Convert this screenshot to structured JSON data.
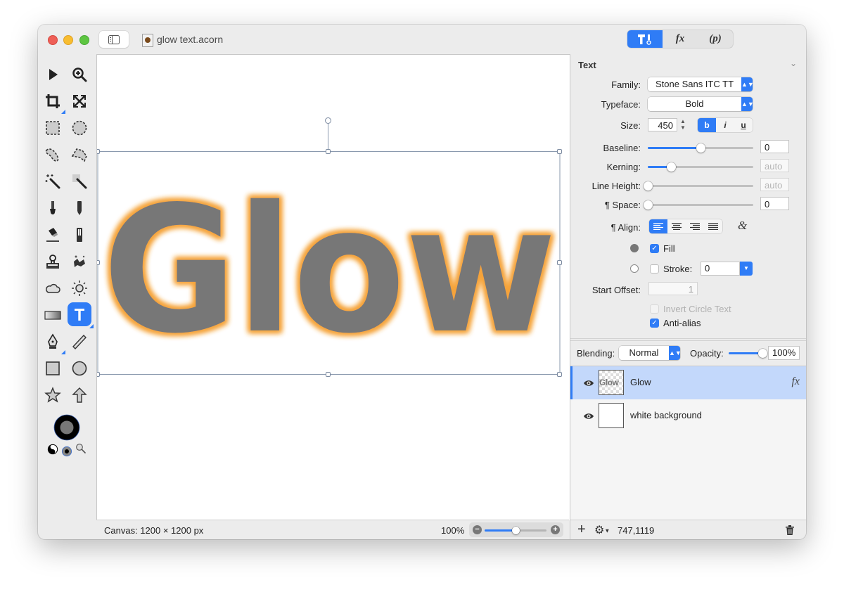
{
  "window": {
    "title": "glow text.acorn",
    "doc_icon": "acorn-document-icon"
  },
  "mode_switcher": {
    "items": [
      {
        "name": "tools",
        "icon": "hammer-brush-icon",
        "label": "",
        "active": true
      },
      {
        "name": "filters",
        "icon": "fx-icon",
        "label": "fx",
        "active": false
      },
      {
        "name": "plugins",
        "icon": "p-icon",
        "label": "(p)",
        "active": false
      }
    ]
  },
  "toolbox": {
    "tools": [
      {
        "name": "move-arrow-tool"
      },
      {
        "name": "zoom-tool"
      },
      {
        "name": "crop-tool"
      },
      {
        "name": "resize-tool"
      },
      {
        "name": "rect-select-tool"
      },
      {
        "name": "ellipse-select-tool"
      },
      {
        "name": "lasso-tool"
      },
      {
        "name": "polygon-lasso-tool"
      },
      {
        "name": "magic-wand-tool"
      },
      {
        "name": "instant-alpha-tool"
      },
      {
        "name": "brush-tool"
      },
      {
        "name": "pencil-tool"
      },
      {
        "name": "paint-bucket-tool"
      },
      {
        "name": "eraser-tool"
      },
      {
        "name": "clone-stamp-tool"
      },
      {
        "name": "smudge-tool"
      },
      {
        "name": "blur-cloud-tool"
      },
      {
        "name": "dodge-burn-sun-tool"
      },
      {
        "name": "gradient-tool"
      },
      {
        "name": "text-tool",
        "active": true
      },
      {
        "name": "bezier-pen-tool"
      },
      {
        "name": "line-tool"
      },
      {
        "name": "rectangle-shape-tool"
      },
      {
        "name": "oval-shape-tool"
      },
      {
        "name": "star-shape-tool"
      },
      {
        "name": "arrow-shape-tool"
      }
    ],
    "stroke_color": "#000000",
    "fill_color": "#777777"
  },
  "canvas": {
    "text": "Glow",
    "text_color": "#777777",
    "glow_color": "#f5a33a",
    "status_label": "Canvas: 1200 × 1200 px",
    "zoom_label": "100%",
    "zoom_value_fraction": 0.5
  },
  "inspector": {
    "title": "Text",
    "family_label": "Family:",
    "family_value": "Stone Sans ITC TT",
    "typeface_label": "Typeface:",
    "typeface_value": "Bold",
    "size_label": "Size:",
    "size_value": "450",
    "style_buttons": [
      {
        "label": "b",
        "active": true
      },
      {
        "label": "i",
        "active": false
      },
      {
        "label": "u",
        "active": false
      }
    ],
    "baseline_label": "Baseline:",
    "baseline_value": "0",
    "baseline_fraction": 0.5,
    "kerning_label": "Kerning:",
    "kerning_value": "auto",
    "kerning_fraction": 0.22,
    "line_height_label": "Line Height:",
    "line_height_value": "auto",
    "line_height_fraction": 0.0,
    "space_label": "¶ Space:",
    "space_value": "0",
    "space_fraction": 0.0,
    "align_label": "¶ Align:",
    "align_options": [
      "left",
      "center",
      "right",
      "justify"
    ],
    "align_selected": "left",
    "ligature_icon": "ampersand-ligature-icon",
    "fill_label": "Fill",
    "fill_checked": true,
    "fill_color": "#777777",
    "stroke_label": "Stroke:",
    "stroke_checked": false,
    "stroke_value": "0",
    "stroke_color": "#ffffff",
    "start_offset_label": "Start Offset:",
    "start_offset_value": "1",
    "invert_circle_label": "Invert Circle Text",
    "invert_circle_checked": false,
    "antialias_label": "Anti-alias",
    "antialias_checked": true
  },
  "layers": {
    "blending_label": "Blending:",
    "blending_value": "Normal",
    "opacity_label": "Opacity:",
    "opacity_value": "100%",
    "opacity_fraction": 1.0,
    "items": [
      {
        "name": "Glow",
        "visible": true,
        "selected": true,
        "has_fx": true,
        "fx_label": "fx",
        "thumb_text": "Glow"
      },
      {
        "name": "white background",
        "visible": true,
        "selected": false,
        "has_fx": false
      }
    ],
    "coords": "747,1119"
  }
}
